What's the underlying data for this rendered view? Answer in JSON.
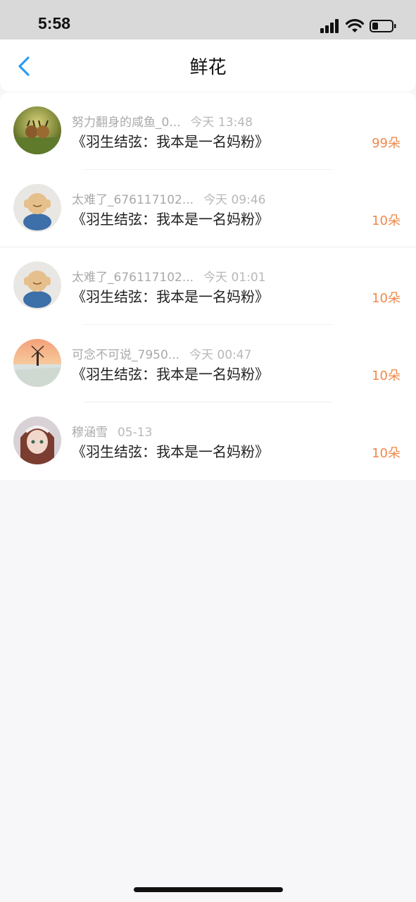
{
  "status_bar": {
    "time": "5:58"
  },
  "nav": {
    "title": "鲜花"
  },
  "items": [
    {
      "name": "努力翻身的咸鱼_0...",
      "time": "今天 13:48",
      "book": "《羽生结弦：我本是一名妈粉》",
      "amount": "99朵",
      "avatar": "snail-avatar-icon"
    },
    {
      "name": "太难了_676117102...",
      "time": "今天 09:46",
      "book": "《羽生结弦：我本是一名妈粉》",
      "amount": "10朵",
      "avatar": "monk-figure-avatar-icon"
    },
    {
      "name": "太难了_676117102...",
      "time": "今天 01:01",
      "book": "《羽生结弦：我本是一名妈粉》",
      "amount": "10朵",
      "avatar": "monk-figure-avatar-icon"
    },
    {
      "name": "可念不可说_7950...",
      "time": "今天 00:47",
      "book": "《羽生结弦：我本是一名妈粉》",
      "amount": "10朵",
      "avatar": "windmill-sunset-avatar-icon"
    },
    {
      "name": "穆涵雪",
      "time": "05-13",
      "book": "《羽生结弦：我本是一名妈粉》",
      "amount": "10朵",
      "avatar": "anime-girl-avatar-icon"
    }
  ],
  "colors": {
    "accent_orange": "#f0884a",
    "back_blue": "#2a9df4"
  }
}
